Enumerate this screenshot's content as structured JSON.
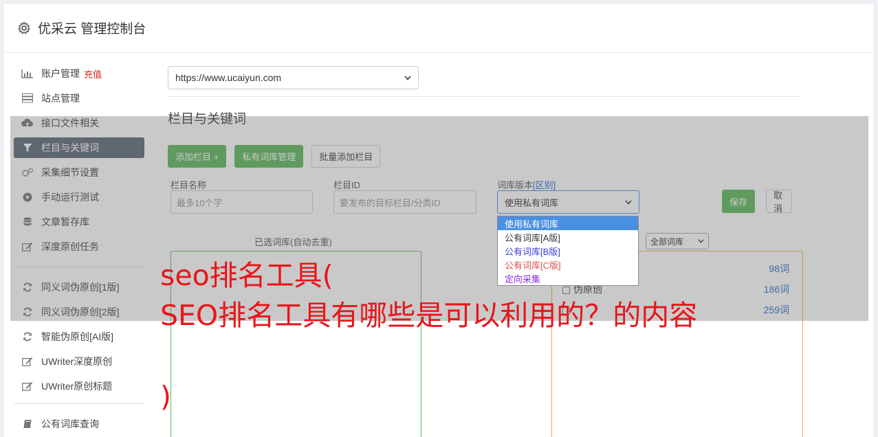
{
  "header": {
    "title": "优采云 管理控制台",
    "icon": "gear-icon"
  },
  "sidebar": {
    "items": [
      {
        "label": "账户管理",
        "badge": "充值",
        "icon": "bar-chart-icon",
        "active": false
      },
      {
        "label": "站点管理",
        "icon": "server-icon",
        "active": false
      },
      {
        "label": "接口文件相关",
        "icon": "cloud-upload-icon",
        "active": false
      },
      {
        "label": "栏目与关键词",
        "icon": "filter-icon",
        "active": true
      },
      {
        "label": "采集细节设置",
        "icon": "gears-icon",
        "active": false
      },
      {
        "label": "手动运行测试",
        "icon": "play-circle-icon",
        "active": false
      },
      {
        "label": "文章暂存库",
        "icon": "database-icon",
        "active": false
      },
      {
        "label": "深度原创任务",
        "icon": "edit-icon",
        "active": false
      }
    ],
    "items2": [
      {
        "label": "同义词伪原创[1版]",
        "icon": "refresh-icon"
      },
      {
        "label": "同义词伪原创[2版]",
        "icon": "refresh-icon"
      },
      {
        "label": "智能伪原创[AI版]",
        "icon": "refresh-icon"
      },
      {
        "label": "UWriter深度原创",
        "icon": "edit-icon"
      },
      {
        "label": "UWriter原创标题",
        "icon": "edit-icon"
      }
    ],
    "items3": [
      {
        "label": "公有词库查询",
        "icon": "book-icon"
      }
    ]
  },
  "main": {
    "site_select_value": "https://www.ucaiyun.com",
    "section_title": "栏目与关键词",
    "buttons": {
      "add_column": "添加栏目 +",
      "private_lib": "私有词库管理",
      "batch_add": "批量添加栏目"
    },
    "form": {
      "name_label": "栏目名称",
      "name_placeholder": "最多10个字",
      "id_label": "栏目ID",
      "id_placeholder": "要发布的目标栏目/分类ID",
      "lib_label": "词库版本",
      "lib_label_link": "[区别]",
      "lib_value": "使用私有词库",
      "save": "保存",
      "cancel": "取消"
    },
    "dropdown_options": [
      {
        "label": "使用私有词库",
        "color": "#ffffff",
        "selected": true
      },
      {
        "label": "公有词库[A版]",
        "color": "#333333",
        "selected": false
      },
      {
        "label": "公有词库[B版]",
        "color": "#3b3bd1",
        "selected": false
      },
      {
        "label": "公有词库[C版]",
        "color": "#d9534f",
        "selected": false
      },
      {
        "label": "定向采集",
        "color": "#8a2be2",
        "selected": false
      }
    ],
    "selected_lib_title": "已选词库(自动去重)",
    "all_lib_select": "全部词库",
    "lib_list": [
      {
        "label": "",
        "count": "98词"
      },
      {
        "label": "伪原创",
        "count": "186词"
      },
      {
        "label": "",
        "count": "259词"
      }
    ]
  },
  "overlay": {
    "headline_line1": "seo排名工具(",
    "headline_line2": "SEO排名工具有哪些是可以利用的？的内容",
    "headline_line3": ")"
  }
}
